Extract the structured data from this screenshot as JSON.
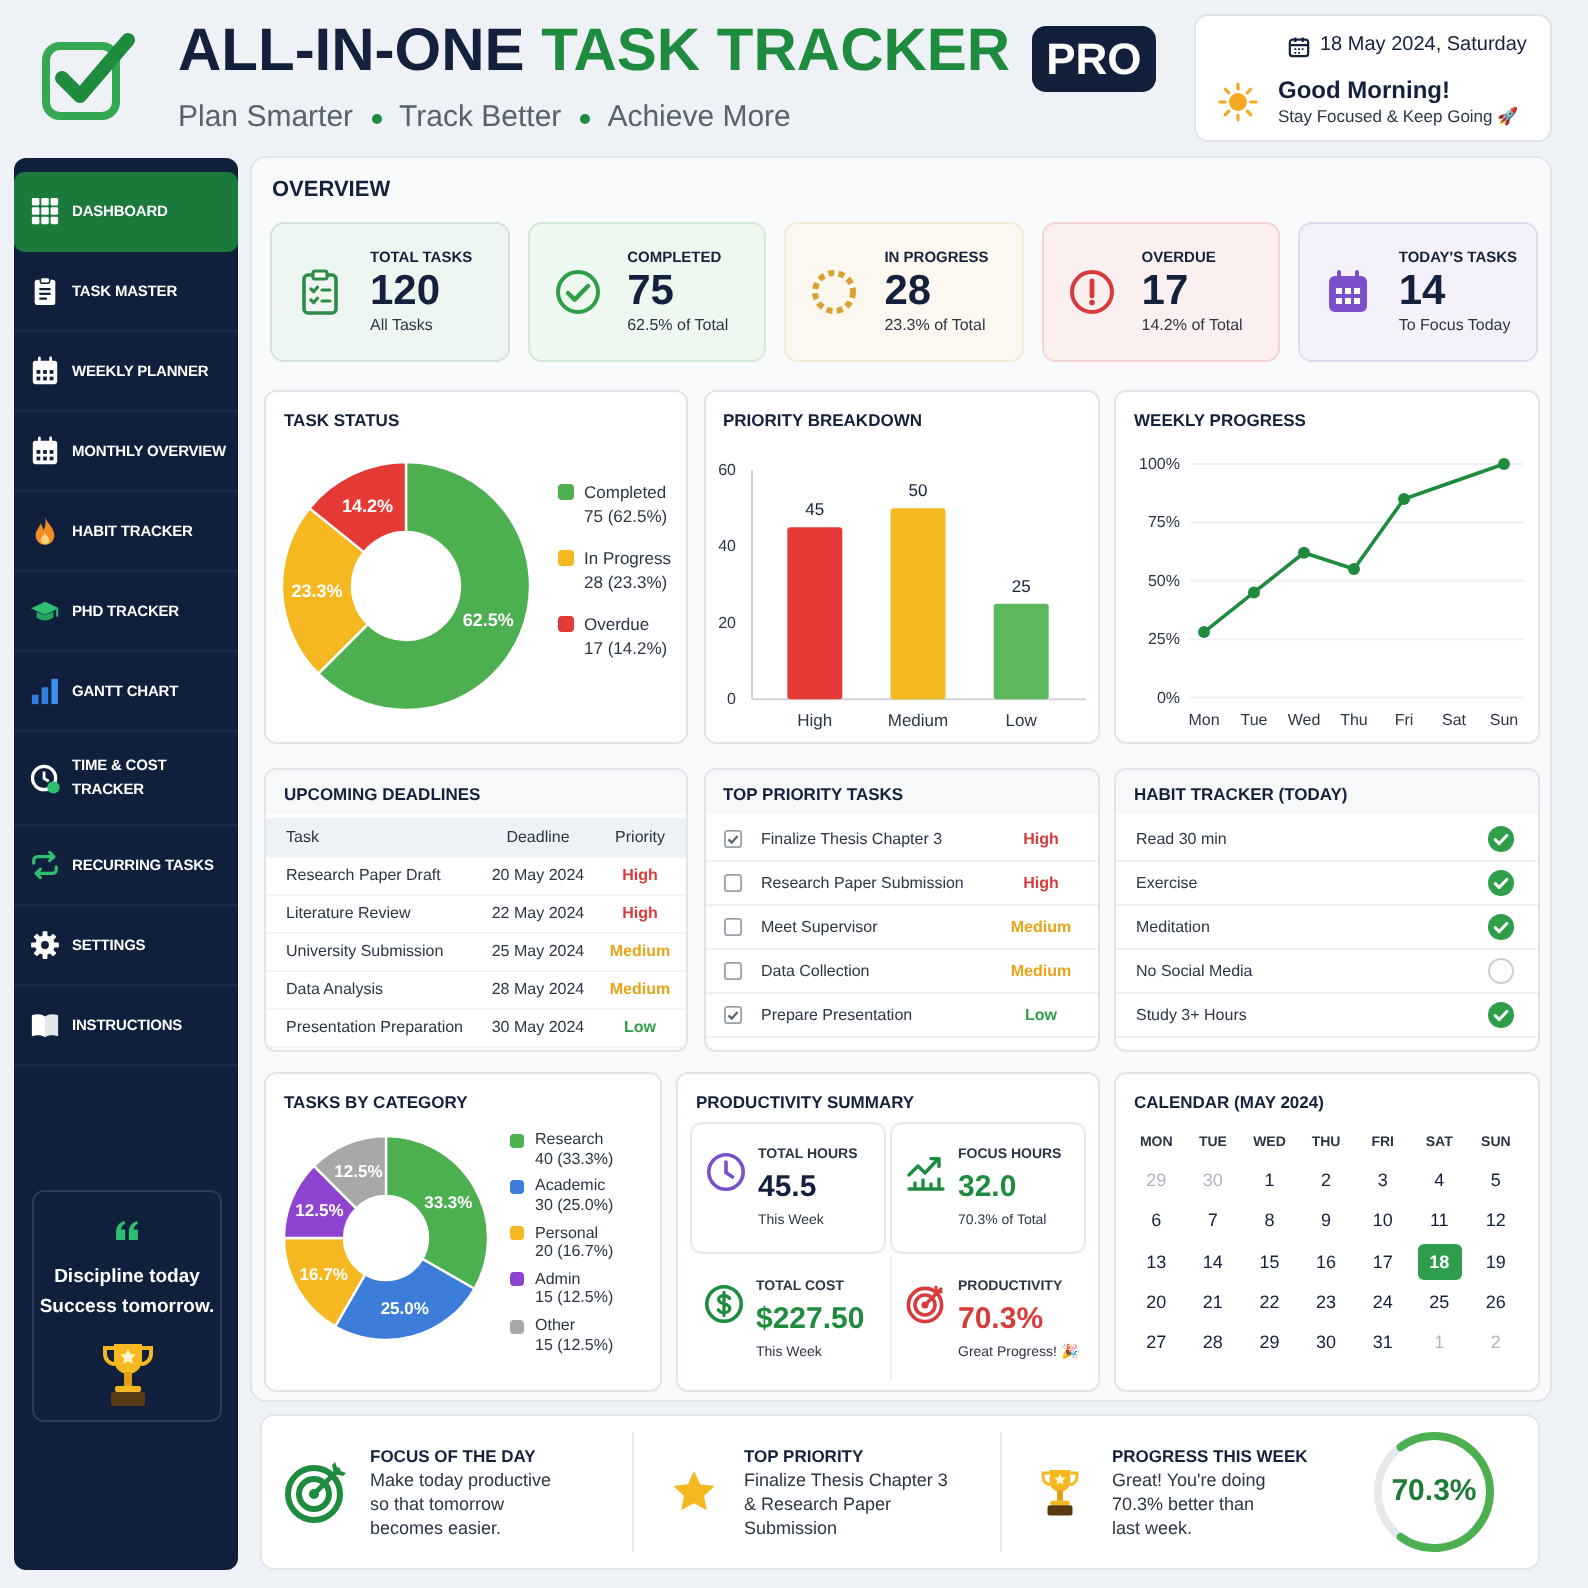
{
  "header": {
    "title_dark": "ALL-IN-ONE",
    "title_green": "TASK TRACKER",
    "badge": "PRO",
    "tagline": [
      "Plan Smarter",
      "Track Better",
      "Achieve More"
    ]
  },
  "date_card": {
    "date": "18 May 2024, Saturday",
    "greeting": "Good Morning!",
    "message": "Stay Focused & Keep Going 🚀"
  },
  "sidebar": {
    "items": [
      {
        "label": "DASHBOARD",
        "selected": true
      },
      {
        "label": "TASK MASTER",
        "selected": false
      },
      {
        "label": "WEEKLY PLANNER",
        "selected": false
      },
      {
        "label": "MONTHLY OVERVIEW",
        "selected": false
      },
      {
        "label": "HABIT TRACKER",
        "selected": false
      },
      {
        "label": "PHD TRACKER",
        "selected": false
      },
      {
        "label": "GANTT CHART",
        "selected": false
      },
      {
        "label": "TIME & COST TRACKER",
        "selected": false
      },
      {
        "label": "RECURRING TASKS",
        "selected": false
      },
      {
        "label": "SETTINGS",
        "selected": false
      },
      {
        "label": "INSTRUCTIONS",
        "selected": false
      }
    ],
    "quote": "Discipline today Success tomorrow."
  },
  "overview": {
    "title": "OVERVIEW",
    "stats": [
      {
        "label": "TOTAL TASKS",
        "value": "120",
        "note": "All Tasks",
        "color": "#2e8b4a"
      },
      {
        "label": "COMPLETED",
        "value": "75",
        "note": "62.5% of Total",
        "color": "#2e9e48"
      },
      {
        "label": "IN PROGRESS",
        "value": "28",
        "note": "23.3% of Total",
        "color": "#d9a233"
      },
      {
        "label": "OVERDUE",
        "value": "17",
        "note": "14.2% of Total",
        "color": "#d93a3a"
      },
      {
        "label": "TODAY'S TASKS",
        "value": "14",
        "note": "To Focus Today",
        "color": "#7b4fc9"
      }
    ]
  },
  "task_status": {
    "title": "TASK STATUS",
    "chart_data": {
      "type": "donut",
      "categories": [
        "Completed",
        "In Progress",
        "Overdue"
      ],
      "values": [
        62.5,
        23.3,
        14.2
      ],
      "value_labels": [
        "62.5%",
        "23.3%",
        "14.2%"
      ]
    },
    "legend": [
      {
        "detail": "75 (62.5%)",
        "color": "#4caf50"
      },
      {
        "detail": "28 (23.3%)",
        "color": "#f5b820"
      },
      {
        "detail": "17 (14.2%)",
        "color": "#e53935"
      }
    ]
  },
  "priority_breakdown": {
    "title": "PRIORITY BREAKDOWN",
    "chart_data": {
      "type": "bar",
      "categories": [
        "High",
        "Medium",
        "Low"
      ],
      "values": [
        45,
        50,
        25
      ],
      "ylim": [
        0,
        60
      ],
      "yticks": [
        0,
        20,
        40,
        60
      ],
      "data_labels": true
    },
    "bars": [
      {
        "color": "#e53935"
      },
      {
        "color": "#f5b820"
      },
      {
        "color": "#5cb85c"
      }
    ]
  },
  "weekly_progress": {
    "title": "WEEKLY PROGRESS",
    "chart_data": {
      "type": "line",
      "categories": [
        "Mon",
        "Tue",
        "Wed",
        "Thu",
        "Fri",
        "Sat",
        "Sun"
      ],
      "values": [
        28,
        45,
        62,
        55,
        85,
        null,
        100
      ],
      "ylim": [
        0,
        100
      ],
      "yticks": [
        {
          "value": 0,
          "label": "0%"
        },
        {
          "value": 25,
          "label": "25%"
        },
        {
          "value": 50,
          "label": "50%"
        },
        {
          "value": 75,
          "label": "75%"
        },
        {
          "value": 100,
          "label": "100%"
        }
      ],
      "grid": true,
      "marker": "circle"
    }
  },
  "upcoming_deadlines": {
    "title": "UPCOMING DEADLINES",
    "columns": [
      "Task",
      "Deadline",
      "Priority"
    ],
    "rows": [
      {
        "task": "Research Paper Draft",
        "deadline": "20 May 2024",
        "priority": "High",
        "color": "#d93a3a"
      },
      {
        "task": "Literature Review",
        "deadline": "22 May 2024",
        "priority": "High",
        "color": "#d93a3a"
      },
      {
        "task": "University Submission",
        "deadline": "25 May 2024",
        "priority": "Medium",
        "color": "#e8a317"
      },
      {
        "task": "Data Analysis",
        "deadline": "28 May 2024",
        "priority": "Medium",
        "color": "#e8a317"
      },
      {
        "task": "Presentation Preparation",
        "deadline": "30 May 2024",
        "priority": "Low",
        "color": "#2e9e48"
      }
    ]
  },
  "top_priority_tasks": {
    "title": "TOP PRIORITY TASKS",
    "items": [
      {
        "task": "Finalize Thesis Chapter 3",
        "checked": true,
        "priority": "High",
        "color": "#d93a3a"
      },
      {
        "task": "Research Paper Submission",
        "checked": false,
        "priority": "High",
        "color": "#d93a3a"
      },
      {
        "task": "Meet Supervisor",
        "checked": false,
        "priority": "Medium",
        "color": "#e8a317"
      },
      {
        "task": "Data Collection",
        "checked": false,
        "priority": "Medium",
        "color": "#e8a317"
      },
      {
        "task": "Prepare Presentation",
        "checked": true,
        "priority": "Low",
        "color": "#2e9e48"
      }
    ]
  },
  "habit_tracker": {
    "title": "HABIT TRACKER (TODAY)",
    "habits": [
      {
        "name": "Read 30 min",
        "done": true
      },
      {
        "name": "Exercise",
        "done": true
      },
      {
        "name": "Meditation",
        "done": true
      },
      {
        "name": "No Social Media",
        "done": false
      },
      {
        "name": "Study 3+ Hours",
        "done": true
      }
    ]
  },
  "tasks_by_category": {
    "title": "TASKS BY CATEGORY",
    "chart_data": {
      "type": "donut",
      "categories": [
        "Research",
        "Academic",
        "Personal",
        "Admin",
        "Other"
      ],
      "values": [
        33.3,
        25.0,
        16.7,
        12.5,
        12.5
      ],
      "value_labels": [
        "33.3%",
        "25.0%",
        "16.7%",
        "12.5%",
        "12.5%"
      ]
    },
    "legend": [
      {
        "detail": "40 (33.3%)",
        "color": "#4caf50"
      },
      {
        "detail": "30 (25.0%)",
        "color": "#3b7dd8"
      },
      {
        "detail": "20 (16.7%)",
        "color": "#f5b820"
      },
      {
        "detail": "15 (12.5%)",
        "color": "#8e44d1"
      },
      {
        "detail": "15 (12.5%)",
        "color": "#a8a8a8"
      }
    ]
  },
  "productivity_summary": {
    "title": "PRODUCTIVITY SUMMARY",
    "tiles": [
      {
        "label": "TOTAL HOURS",
        "value": "45.5",
        "note": "This Week",
        "color": "#7b4fc9",
        "highlighted": false
      },
      {
        "label": "FOCUS HOURS",
        "value": "32.0",
        "note": "70.3% of Total",
        "color": "#1e8b3f",
        "highlighted": true
      },
      {
        "label": "TOTAL COST",
        "value": "$227.50",
        "note": "This Week",
        "color": "#1e8b3f",
        "highlighted": true
      },
      {
        "label": "PRODUCTIVITY",
        "value": "70.3%",
        "note": "Great Progress! 🎉",
        "color": "#d93a3a",
        "highlighted": true
      }
    ]
  },
  "calendar": {
    "title": "CALENDAR (MAY 2024)",
    "weekdays": [
      "MON",
      "TUE",
      "WED",
      "THU",
      "FRI",
      "SAT",
      "SUN"
    ],
    "days": [
      {
        "day": "29",
        "outside_month": true,
        "selected": false
      },
      {
        "day": "30",
        "outside_month": true,
        "selected": false
      },
      {
        "day": "1",
        "outside_month": false,
        "selected": false
      },
      {
        "day": "2",
        "outside_month": false,
        "selected": false
      },
      {
        "day": "3",
        "outside_month": false,
        "selected": false
      },
      {
        "day": "4",
        "outside_month": false,
        "selected": false
      },
      {
        "day": "5",
        "outside_month": false,
        "selected": false
      },
      {
        "day": "6",
        "outside_month": false,
        "selected": false
      },
      {
        "day": "7",
        "outside_month": false,
        "selected": false
      },
      {
        "day": "8",
        "outside_month": false,
        "selected": false
      },
      {
        "day": "9",
        "outside_month": false,
        "selected": false
      },
      {
        "day": "10",
        "outside_month": false,
        "selected": false
      },
      {
        "day": "11",
        "outside_month": false,
        "selected": false
      },
      {
        "day": "12",
        "outside_month": false,
        "selected": false
      },
      {
        "day": "13",
        "outside_month": false,
        "selected": false
      },
      {
        "day": "14",
        "outside_month": false,
        "selected": false
      },
      {
        "day": "15",
        "outside_month": false,
        "selected": false
      },
      {
        "day": "16",
        "outside_month": false,
        "selected": false
      },
      {
        "day": "17",
        "outside_month": false,
        "selected": false
      },
      {
        "day": "18",
        "outside_month": false,
        "selected": true
      },
      {
        "day": "19",
        "outside_month": false,
        "selected": false
      },
      {
        "day": "20",
        "outside_month": false,
        "selected": false
      },
      {
        "day": "21",
        "outside_month": false,
        "selected": false
      },
      {
        "day": "22",
        "outside_month": false,
        "selected": false
      },
      {
        "day": "23",
        "outside_month": false,
        "selected": false
      },
      {
        "day": "24",
        "outside_month": false,
        "selected": false
      },
      {
        "day": "25",
        "outside_month": false,
        "selected": false
      },
      {
        "day": "26",
        "outside_month": false,
        "selected": false
      },
      {
        "day": "27",
        "outside_month": false,
        "selected": false
      },
      {
        "day": "28",
        "outside_month": false,
        "selected": false
      },
      {
        "day": "29",
        "outside_month": false,
        "selected": false
      },
      {
        "day": "30",
        "outside_month": false,
        "selected": false
      },
      {
        "day": "31",
        "outside_month": false,
        "selected": false
      },
      {
        "day": "1",
        "outside_month": true,
        "selected": false
      },
      {
        "day": "2",
        "outside_month": true,
        "selected": false
      }
    ]
  },
  "bottom": {
    "focus": {
      "title": "FOCUS OF THE DAY",
      "text": "Make today productive so that tomorrow becomes easier."
    },
    "top_priority": {
      "title": "TOP PRIORITY",
      "text": "Finalize Thesis Chapter 3 & Research Paper Submission"
    },
    "progress": {
      "title": "PROGRESS THIS WEEK",
      "text": "Great! You're doing 70.3% better than last week.",
      "level": 0.703,
      "reading": "70.3%"
    }
  }
}
